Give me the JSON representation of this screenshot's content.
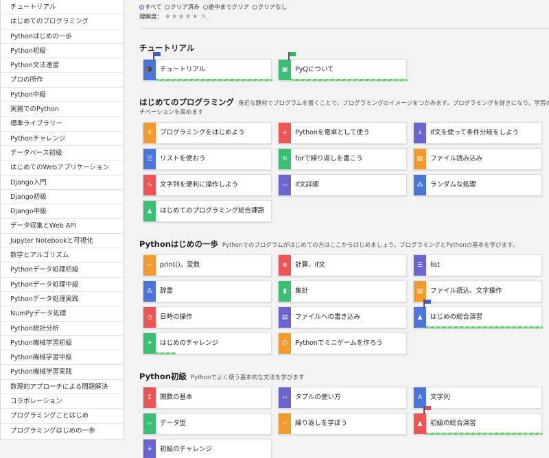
{
  "sidebar": {
    "items": [
      "チュートリアル",
      "はじめてのプログラミング",
      "Pythonはじめの一歩",
      "Python初級",
      "Python文法速習",
      "プロの所作",
      "Python中級",
      "実務でのPython",
      "標準ライブラリー",
      "Pythonチャレンジ",
      "データベース初級",
      "はじめてのWebアプリケーション",
      "Django入門",
      "Django初級",
      "Django中級",
      "データ収集とWeb API",
      "Jupyter Notebookと可視化",
      "数学とアルゴリズム",
      "Pythonデータ処理初級",
      "Pythonデータ処理中級",
      "Pythonデータ処理実践",
      "NumPyデータ処理",
      "Python統計分析",
      "Python機械学習初級",
      "Python機械学習中級",
      "Python機械学習実践",
      "数理的アプローチによる問題解決",
      "コラボレーション",
      "プログラミングことはじめ",
      "プログラミングはじめの一歩"
    ]
  },
  "filters": {
    "options": [
      "すべて",
      "クリア済み",
      "途中までクリア",
      "クリアなし"
    ],
    "rating_label": "理解度：",
    "stars": "★★★★★",
    "clear_glyph": "✕"
  },
  "sections": [
    {
      "title": "チュートリアル",
      "desc": "",
      "desc2": ""
    },
    {
      "title": "はじめてのプログラミング",
      "desc": "身近な題材でプログラムを書くことで、プログラミングのイメージをつかみます。プログラミングを好きになり、学習のモ",
      "desc2": "チベーションを高めます"
    },
    {
      "title": "Pythonはじめの一歩",
      "desc": "Pythonでのプログラムがはじめての方はここからはじめましょう。プログラミングとPythonの基本を学びます。",
      "desc2": ""
    },
    {
      "title": "Python初級",
      "desc": "Pythonでよく使う基本的な文法を学びます",
      "desc2": ""
    }
  ],
  "cards": [
    {
      "label": "チュートリアル",
      "icon": "🎓",
      "color": "blue",
      "progress": 1.0,
      "flag": "#3a63d8"
    },
    {
      "label": "PyQについて",
      "icon": "▣",
      "color": "green",
      "progress": 1.0,
      "flag": "#35b55c"
    },
    {
      "label": "プログラミングをはじめよう",
      "icon": "≛",
      "color": "orange",
      "progress": 0,
      "flag": ""
    },
    {
      "label": "Pythonを電卓として使う",
      "icon": "+",
      "color": "red",
      "progress": 0,
      "flag": ""
    },
    {
      "label": "if文を使って条件分岐をしよう",
      "icon": "⅄",
      "color": "purple",
      "progress": 0,
      "flag": ""
    },
    {
      "label": "リストを使おう",
      "icon": "☰",
      "color": "blue",
      "progress": 0,
      "flag": ""
    },
    {
      "label": "forで繰り返しを書こう",
      "icon": "↻",
      "color": "green",
      "progress": 0,
      "flag": ""
    },
    {
      "label": "ファイル読み込み",
      "icon": "▤",
      "color": "orange",
      "progress": 0,
      "flag": ""
    },
    {
      "label": "文字列を便利に操作しよう",
      "icon": "∿",
      "color": "red",
      "progress": 0,
      "flag": ""
    },
    {
      "label": "if文詳細",
      "icon": "‹›",
      "color": "purple",
      "progress": 0,
      "flag": ""
    },
    {
      "label": "ランダムな処理",
      "icon": "⁂",
      "color": "blue",
      "progress": 0,
      "flag": ""
    },
    {
      "label": "はじめてのプログラミング総合課題",
      "icon": "▲",
      "color": "green",
      "progress": 0,
      "flag": ""
    },
    {
      "label": "print()、変数",
      "icon": "‹›",
      "color": "orange",
      "progress": 0,
      "flag": ""
    },
    {
      "label": "計算、if文",
      "icon": "⊕",
      "color": "red",
      "progress": 0,
      "flag": ""
    },
    {
      "label": "list",
      "icon": "☰",
      "color": "purple",
      "progress": 0,
      "flag": ""
    },
    {
      "label": "辞書",
      "icon": "⁂",
      "color": "blue",
      "progress": 0,
      "flag": ""
    },
    {
      "label": "集計",
      "icon": "▮",
      "color": "green",
      "progress": 0,
      "flag": ""
    },
    {
      "label": "ファイル読込、文字操作",
      "icon": "▤",
      "color": "orange",
      "progress": 0,
      "flag": ""
    },
    {
      "label": "日時の操作",
      "icon": "◷",
      "color": "red",
      "progress": 0,
      "flag": ""
    },
    {
      "label": "ファイルへの書き込み",
      "icon": "▤",
      "color": "purple",
      "progress": 0,
      "flag": ""
    },
    {
      "label": "はじめの総合演習",
      "icon": "▲",
      "color": "blue",
      "progress": 1.0,
      "flag": "#3a63d8"
    },
    {
      "label": "はじめのチャレンジ",
      "icon": "✈",
      "color": "green",
      "progress": 0.17,
      "flag": ""
    },
    {
      "label": "Pythonでミニゲームを作ろう",
      "icon": "☺",
      "color": "orange",
      "progress": 0,
      "flag": ""
    },
    {
      "label": "関数の基本",
      "icon": "Σ",
      "color": "red",
      "progress": 0,
      "flag": ""
    },
    {
      "label": "タプルの使い方",
      "icon": "‹›",
      "color": "purple",
      "progress": 0,
      "flag": ""
    },
    {
      "label": "文字列",
      "icon": "A",
      "color": "blue",
      "progress": 0,
      "flag": ""
    },
    {
      "label": "データ型",
      "icon": "‹›",
      "color": "green",
      "progress": 0,
      "flag": ""
    },
    {
      "label": "繰り返しを学ぼう",
      "icon": "‹›",
      "color": "orange",
      "progress": 0,
      "flag": ""
    },
    {
      "label": "初級の総合演習",
      "icon": "▲",
      "color": "red",
      "progress": 1.0,
      "flag": "#e84a4a"
    },
    {
      "label": "初級のチャレンジ",
      "icon": "✈",
      "color": "purple",
      "progress": 0,
      "flag": ""
    }
  ]
}
